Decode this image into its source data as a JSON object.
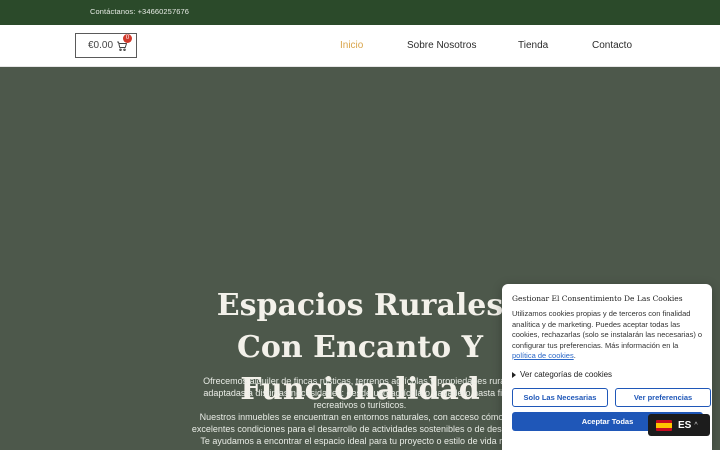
{
  "topbar": {
    "contact_text": "Contáctanos: +34660257676"
  },
  "header": {
    "cart": {
      "amount": "€0.00",
      "count": "0"
    },
    "nav": [
      {
        "label": "Inicio",
        "active": true
      },
      {
        "label": "Sobre Nosotros"
      },
      {
        "label": "Tienda"
      },
      {
        "label": "Contacto"
      }
    ]
  },
  "hero": {
    "title": "Espacios Rurales Con Encanto Y Funcionalidad",
    "paragraph_1": "Ofrecemos alquiler de fincas rústicas, terrenos agrícolas y propiedades rurales adaptadas a distintas necesidades: desde uso agrícola o ganadero hasta fines recreativos o turísticos.",
    "paragraph_2": "Nuestros inmuebles se encuentran en entornos naturales, con acceso cómodo y excelentes condiciones para el desarrollo de actividades sostenibles o de descanso.",
    "paragraph_3": "Te ayudamos a encontrar el espacio ideal para tu proyecto o estilo de vida rural."
  },
  "cookie": {
    "title": "Gestionar El Consentimiento De Las Cookies",
    "body": "Utilizamos cookies propias y de terceros con finalidad analítica y de marketing. Puedes aceptar todas las cookies, rechazarlas (solo se instalarán las necesarias) o configurar tus preferencias. Más información en la",
    "link": "política de cookies",
    "body_end": ".",
    "categories": "Ver categorías de cookies",
    "btn_necesarias": "Solo Las Necesarias",
    "btn_preferencias": "Ver preferencias",
    "btn_todas": "Aceptar Todas"
  },
  "language": {
    "code": "ES",
    "chevron": "^"
  },
  "colors": {
    "topbar": "#2b4a2a",
    "hero": "#4d584b",
    "nav_active": "#d9a54b",
    "cookie_primary": "#1f57b8",
    "badge": "#d0392b"
  }
}
